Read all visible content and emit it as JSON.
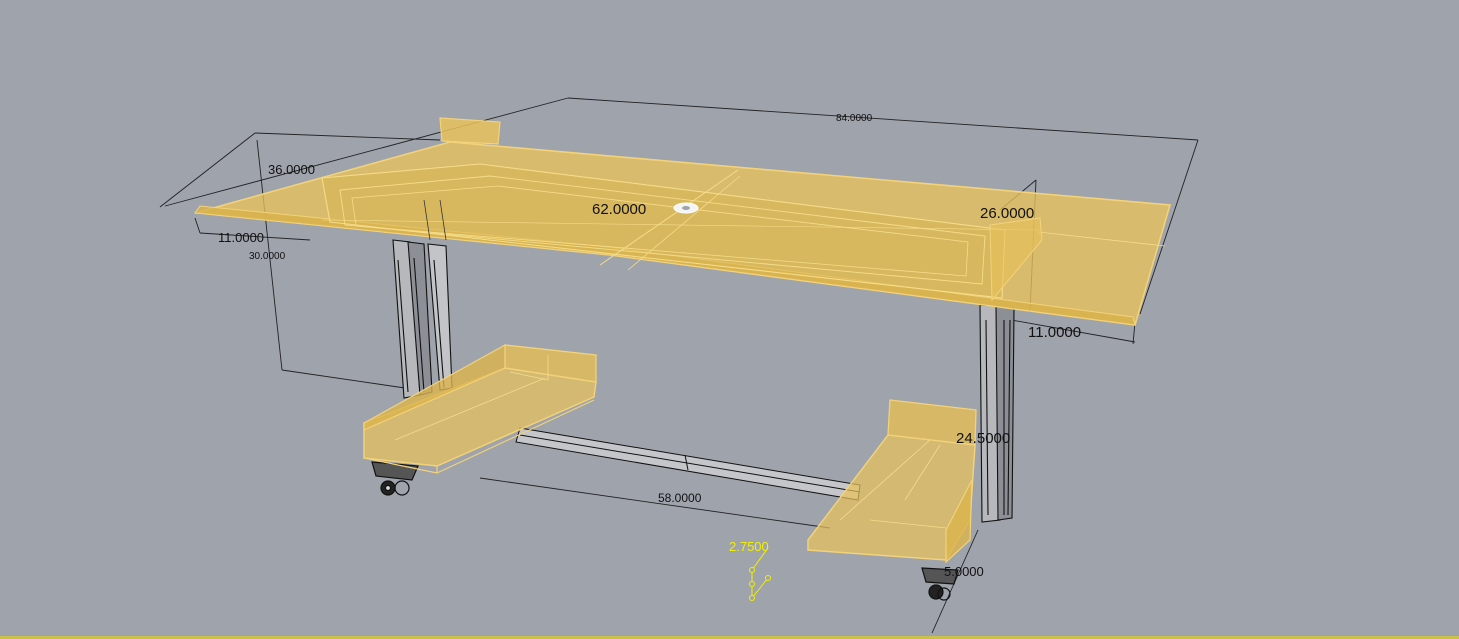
{
  "viewport": {
    "background_color": "#9ea3ac",
    "selection_color": "#e8c25a",
    "selection_edge_color": "#f2d27a",
    "wire_color": "#1a1a1a",
    "dimensions": {
      "overall_length": "84.0000",
      "overall_depth": "36.0000",
      "left_overhang": "11.0000",
      "height": "30.0000",
      "opening_length": "62.0000",
      "opening_depth": "26.0000",
      "right_overhang": "11.0000",
      "leg_height": "24.5000",
      "stretcher_length": "58.0000",
      "foot_width": "5.0000",
      "active_dimension": "2.7500"
    },
    "active_dimension_color": "#f4f000"
  }
}
